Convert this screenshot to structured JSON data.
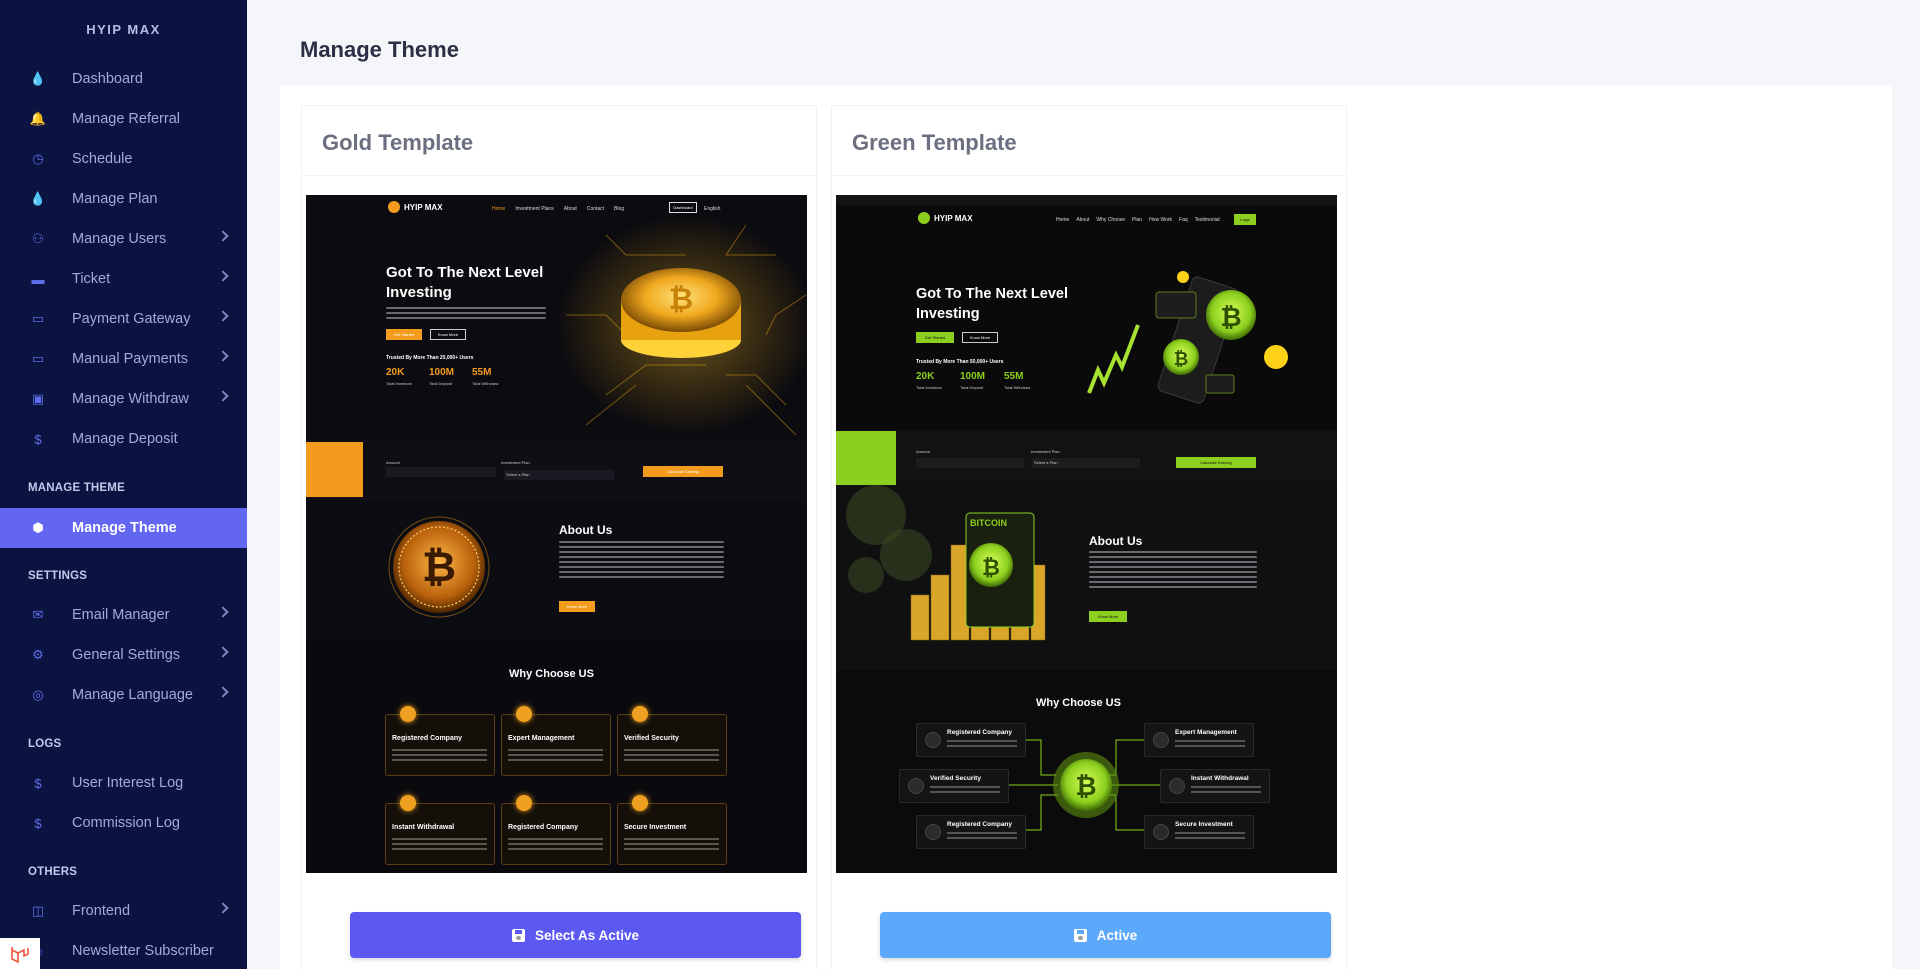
{
  "sidebar": {
    "brand": "HYIP MAX",
    "items": [
      {
        "label": "Dashboard",
        "icon": "flame-icon",
        "chevron": false
      },
      {
        "label": "Manage Referral",
        "icon": "bell-icon",
        "chevron": false
      },
      {
        "label": "Schedule",
        "icon": "clock-icon",
        "chevron": false
      },
      {
        "label": "Manage Plan",
        "icon": "flame-icon",
        "chevron": false
      },
      {
        "label": "Manage Users",
        "icon": "users-icon",
        "chevron": true
      },
      {
        "label": "Ticket",
        "icon": "ticket-icon",
        "chevron": true
      },
      {
        "label": "Payment Gateway",
        "icon": "credit-card-icon",
        "chevron": true
      },
      {
        "label": "Manual Payments",
        "icon": "credit-card-icon",
        "chevron": true
      },
      {
        "label": "Manage Withdraw",
        "icon": "money-icon",
        "chevron": true
      },
      {
        "label": "Manage Deposit",
        "icon": "dollar-icon",
        "chevron": false
      }
    ],
    "section_manage_theme": "MANAGE THEME",
    "manage_theme_item": "Manage Theme",
    "section_settings": "SETTINGS",
    "settings_items": [
      {
        "label": "Email Manager",
        "icon": "envelope-icon"
      },
      {
        "label": "General Settings",
        "icon": "gear-icon"
      },
      {
        "label": "Manage Language",
        "icon": "globe-icon"
      }
    ],
    "section_logs": "LOGS",
    "log_items": [
      {
        "label": "User Interest Log",
        "icon": "dollar-icon"
      },
      {
        "label": "Commission Log",
        "icon": "dollar-icon"
      }
    ],
    "section_others": "OTHERS",
    "other_items": [
      {
        "label": "Frontend",
        "icon": "columns-icon"
      },
      {
        "label": "Newsletter Subscriber",
        "icon": "user-icon"
      }
    ]
  },
  "page": {
    "title": "Manage Theme"
  },
  "templates": [
    {
      "title": "Gold Template",
      "button_label": "Select As Active",
      "accent": "#f29b1d",
      "preview": {
        "logo": "HYIP MAX",
        "nav_links": [
          "Home",
          "Investment Plans",
          "About",
          "Contact",
          "Blog"
        ],
        "dashboard_btn": "Dashboard",
        "lang": "English",
        "hero_title": "Got To The Next Level Investing",
        "btn_primary": "Get Started",
        "btn_secondary": "Know More",
        "trusted": "Trusted By More Than 20,000+ Users",
        "stats": [
          {
            "value": "20K",
            "label": "Total Investors"
          },
          {
            "value": "100M",
            "label": "Total Deposit"
          },
          {
            "value": "55M",
            "label": "Total Withdraw"
          }
        ],
        "calc_amount": "Amount",
        "calc_plan": "Investment Plan",
        "calc_plan_value": "Select a Plan",
        "calc_button": "Calculate Earning",
        "about_title": "About Us",
        "about_btn": "Know More",
        "why_title": "Why Choose US",
        "features": [
          "Registered Company",
          "Expert Management",
          "Verified Security",
          "Instant Withdrawal",
          "Registered Company",
          "Secure Investment"
        ]
      }
    },
    {
      "title": "Green Template",
      "button_label": "Active",
      "accent": "#8ccf1e",
      "preview": {
        "logo": "HYIP MAX",
        "nav_links": [
          "Home",
          "About",
          "Why Choose",
          "Plan",
          "How Work",
          "Faq",
          "Testimonial"
        ],
        "login_btn": "Login",
        "hero_title": "Got To The Next Level Investing",
        "btn_primary": "Get Started",
        "btn_secondary": "Know More",
        "trusted": "Trusted By More Than 50,000+ Users",
        "stats": [
          {
            "value": "20K",
            "label": "Total Investors"
          },
          {
            "value": "100M",
            "label": "Total Deposit"
          },
          {
            "value": "55M",
            "label": "Total Withdraw"
          }
        ],
        "calc_amount": "Amount",
        "calc_plan": "Investment Plan",
        "calc_plan_value": "Select a Plan",
        "calc_button": "Calculate Earning",
        "btc_label": "BITCOIN",
        "about_title": "About Us",
        "about_btn": "Know More",
        "why_title": "Why Choose US",
        "features": [
          "Registered Company",
          "Expert Management",
          "Verified Security",
          "Instant Withdrawal",
          "Registered Company",
          "Secure Investment"
        ]
      }
    }
  ]
}
